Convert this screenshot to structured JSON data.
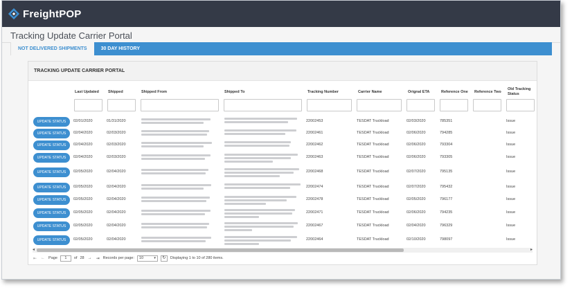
{
  "brand": {
    "name": "FreightPOP"
  },
  "page": {
    "title": "Tracking Update Carrier Portal"
  },
  "tabs": [
    {
      "label": "NOT DELIVERED SHIPMENTS",
      "active": true
    },
    {
      "label": "30 DAY HISTORY",
      "active": false
    }
  ],
  "panel": {
    "title": "TRACKING UPDATE CARRIER PORTAL"
  },
  "columns": {
    "last_updated": "Last Updated",
    "shipped": "Shipped",
    "shipped_from": "Shipped From",
    "shipped_to": "Shipped To",
    "tracking_number": "Tracking Number",
    "carrier_name": "Carrier Name",
    "original_eta": "Orignal ETA",
    "reference_one": "Reference One",
    "reference_two": "Reference Two",
    "old_tracking_status_1": "Old Tracking",
    "old_tracking_status_2": "Status"
  },
  "row_button_label": "UPDATE STATUS",
  "rows": [
    {
      "last_updated": "02/01/2020",
      "shipped": "01/31/2020",
      "tracking": "22002453",
      "carrier": "TESDAT Truckload",
      "eta": "02/03/2020",
      "ref1": "785351",
      "status": "Issue"
    },
    {
      "last_updated": "02/04/2020",
      "shipped": "02/03/2020",
      "tracking": "22002461",
      "carrier": "TESDAT Truckload",
      "eta": "02/06/2020",
      "ref1": "794285",
      "status": "Issue"
    },
    {
      "last_updated": "02/04/2020",
      "shipped": "02/03/2020",
      "tracking": "22002462",
      "carrier": "TESDAT Truckload",
      "eta": "02/06/2020",
      "ref1": "793304",
      "status": "Issue"
    },
    {
      "last_updated": "02/04/2020",
      "shipped": "02/03/2020",
      "tracking": "22002463",
      "carrier": "TESDAT Truckload",
      "eta": "02/06/2020",
      "ref1": "793305",
      "status": "Issue"
    },
    {
      "last_updated": "02/05/2020",
      "shipped": "02/04/2020",
      "tracking": "22002468",
      "carrier": "TESDAT Truckload",
      "eta": "02/07/2020",
      "ref1": "795135",
      "status": "Issue"
    },
    {
      "last_updated": "02/05/2020",
      "shipped": "02/04/2020",
      "tracking": "22002474",
      "carrier": "TESDAT Truckload",
      "eta": "02/07/2020",
      "ref1": "795432",
      "status": "Issue"
    },
    {
      "last_updated": "02/05/2020",
      "shipped": "02/04/2020",
      "tracking": "22002478",
      "carrier": "TESDAT Truckload",
      "eta": "02/05/2020",
      "ref1": "796177",
      "status": "Issue"
    },
    {
      "last_updated": "02/05/2020",
      "shipped": "02/04/2020",
      "tracking": "22002471",
      "carrier": "TESDAT Truckload",
      "eta": "02/06/2020",
      "ref1": "794235",
      "status": "Issue"
    },
    {
      "last_updated": "02/05/2020",
      "shipped": "02/04/2020",
      "tracking": "22002467",
      "carrier": "TESDAT Truckload",
      "eta": "02/04/2020",
      "ref1": "796329",
      "status": "Issue"
    },
    {
      "last_updated": "02/05/2020",
      "shipped": "02/04/2020",
      "tracking": "22002464",
      "carrier": "TESDAT Truckload",
      "eta": "02/10/2020",
      "ref1": "798097",
      "status": "Issue"
    }
  ],
  "pager": {
    "page_label": "Page",
    "current_page": "1",
    "of_label": "of",
    "total_pages": "28",
    "records_label": "Records per page:",
    "records_value": "10",
    "summary": "Displaying 1 to 10 of 280 items."
  },
  "colors": {
    "topbar": "#343a47",
    "accent": "#3d8fd0"
  }
}
